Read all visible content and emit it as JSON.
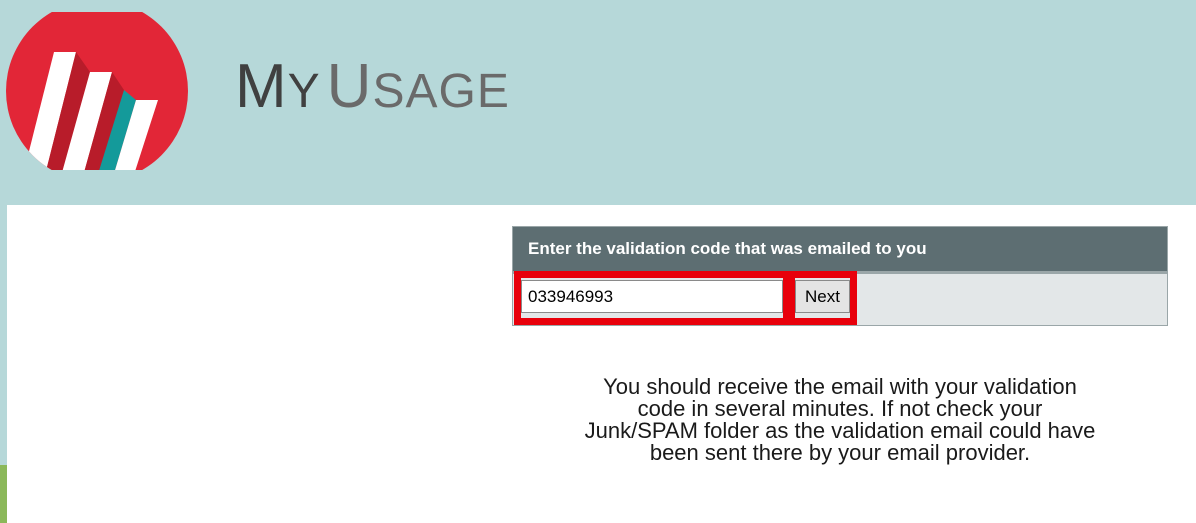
{
  "header": {
    "brand_first_cap": "M",
    "brand_first_rest": "Y",
    "brand_second_cap": "U",
    "brand_second_rest": "SAGE",
    "logo_icon": "myusage-logo-icon",
    "background_color": "#b6d8d9"
  },
  "validation": {
    "panel_title": "Enter the validation code that was emailed to you",
    "code_value": "033946993",
    "next_label": "Next",
    "highlight_color": "#e8000b"
  },
  "info": {
    "line1": "You should receive the email with your validation",
    "line2": "code in several minutes. If not check your",
    "line3": "Junk/SPAM folder as the validation email could have",
    "line4": "been sent there by your email provider."
  }
}
